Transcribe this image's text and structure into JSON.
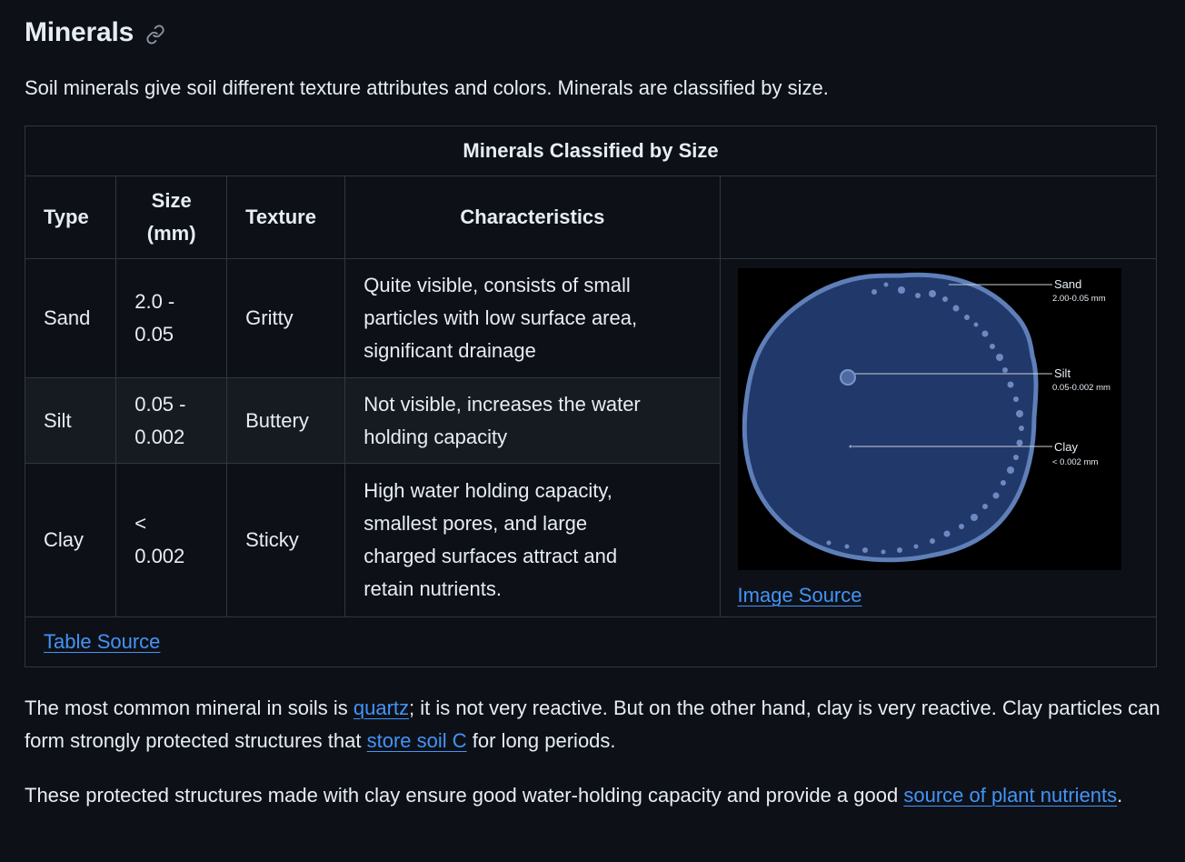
{
  "section": {
    "title": "Minerals",
    "intro": "Soil minerals give soil different texture attributes and colors. Minerals are classified by size."
  },
  "table": {
    "caption": "Minerals Classified by Size",
    "headers": {
      "type": "Type",
      "size_line1": "Size",
      "size_line2": "(mm)",
      "texture": "Texture",
      "characteristics": "Characteristics"
    },
    "rows": [
      {
        "type": "Sand",
        "size_line1": "2.0 -",
        "size_line2": "0.05",
        "texture": "Gritty",
        "characteristics": [
          "Quite visible, consists of small",
          "particles with low surface area,",
          "significant drainage"
        ]
      },
      {
        "type": "Silt",
        "size_line1": "0.05 -",
        "size_line2": "0.002",
        "texture": "Buttery",
        "characteristics": [
          "Not visible, increases the water",
          "holding capacity"
        ]
      },
      {
        "type": "Clay",
        "size_line1": "<",
        "size_line2": "0.002",
        "texture": "Sticky",
        "characteristics": [
          "High water holding capacity,",
          "smallest pores, and large",
          "charged surfaces attract and",
          "retain nutrients."
        ]
      }
    ],
    "image": {
      "labels": {
        "sand": "Sand",
        "sand_size": "2.00-0.05 mm",
        "silt": "Silt",
        "silt_size": "0.05-0.002 mm",
        "clay": "Clay",
        "clay_size": "< 0.002 mm"
      },
      "source_link": "Image Source"
    },
    "table_source_link": "Table Source"
  },
  "paragraphs": {
    "p1": {
      "before": "The most common mineral in soils is ",
      "link1": "quartz",
      "middle": "; it is not very reactive. But on the other hand, clay is very reactive. Clay particles can form strongly protected structures that ",
      "link2": "store soil C",
      "after": " for long periods."
    },
    "p2": {
      "before": "These protected structures made with clay ensure good water-holding capacity and provide a good ",
      "link": "source of plant nutrients",
      "after": "."
    }
  },
  "colors": {
    "background": "#0d1117",
    "text": "#e6edf3",
    "link": "#4493f8",
    "border": "#30363d",
    "row_alt": "#161b22"
  },
  "icons": {
    "anchor": "link-icon"
  }
}
